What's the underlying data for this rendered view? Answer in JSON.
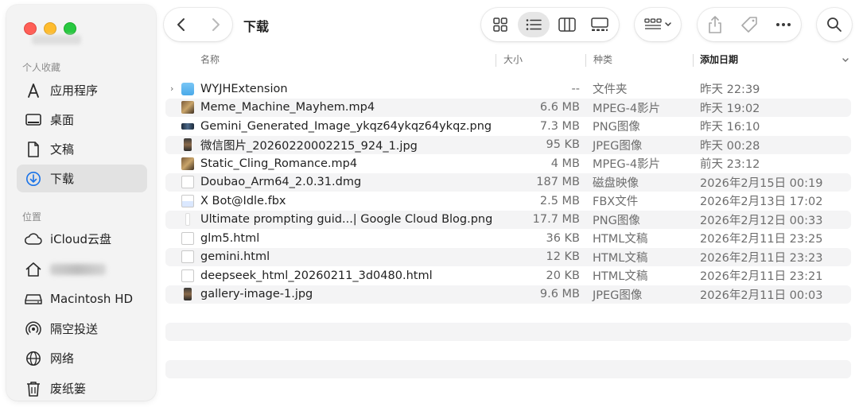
{
  "window": {
    "title": "下载",
    "colors": {
      "accent": "#1a73e8",
      "red": "#ff5f57",
      "yellow": "#febc2e",
      "green": "#28c840",
      "row_alt": "#f4f4f5"
    }
  },
  "sidebar": {
    "favorites_title": "个人收藏",
    "locations_title": "位置",
    "favorites": [
      {
        "label": "应用程序",
        "icon": "applications-icon"
      },
      {
        "label": "桌面",
        "icon": "desktop-icon"
      },
      {
        "label": "文稿",
        "icon": "document-icon"
      },
      {
        "label": "下载",
        "icon": "download-icon",
        "selected": true
      }
    ],
    "locations": [
      {
        "label": "iCloud云盘",
        "icon": "cloud-icon"
      },
      {
        "label": "",
        "icon": "home-icon",
        "obscured": true
      },
      {
        "label": "Macintosh HD",
        "icon": "disk-icon"
      },
      {
        "label": "隔空投送",
        "icon": "airdrop-icon"
      },
      {
        "label": "网络",
        "icon": "globe-icon"
      },
      {
        "label": "废纸篓",
        "icon": "trash-icon"
      }
    ]
  },
  "toolbar": {
    "back_icon": "chevron-left-icon",
    "forward_icon": "chevron-right-icon",
    "view_icons": [
      "icon-view-icon",
      "list-view-icon",
      "column-view-icon",
      "gallery-view-icon"
    ],
    "active_view": "list-view-icon",
    "group_icon": "group-by-icon",
    "share_icon": "share-icon",
    "tag_icon": "tag-icon",
    "more_icon": "ellipsis-icon",
    "search_icon": "search-icon"
  },
  "columns": {
    "name": "名称",
    "size": "大小",
    "kind": "种类",
    "date": "添加日期"
  },
  "files": [
    {
      "name": "WYJHExtension",
      "size": "--",
      "kind": "文件夹",
      "date": "昨天 22:39",
      "type": "folder"
    },
    {
      "name": "Meme_Machine_Mayhem.mp4",
      "size": "6.6 MB",
      "kind": "MPEG-4影片",
      "date": "昨天 19:02",
      "type": "video"
    },
    {
      "name": "Gemini_Generated_Image_ykqz64ykqz64ykqz.png",
      "size": "7.3 MB",
      "kind": "PNG图像",
      "date": "昨天 16:10",
      "type": "image-dark"
    },
    {
      "name": "微信图片_20260220002215_924_1.jpg",
      "size": "95 KB",
      "kind": "JPEG图像",
      "date": "昨天 00:28",
      "type": "image-phone"
    },
    {
      "name": "Static_Cling_Romance.mp4",
      "size": "4 MB",
      "kind": "MPEG-4影片",
      "date": "前天 23:12",
      "type": "video"
    },
    {
      "name": "Doubao_Arm64_2.0.31.dmg",
      "size": "187 MB",
      "kind": "磁盘映像",
      "date": "2026年2月15日 00:19",
      "type": "doc"
    },
    {
      "name": "X Bot@Idle.fbx",
      "size": "2.5 MB",
      "kind": "FBX文件",
      "date": "2026年2月13日 17:02",
      "type": "doc-blue"
    },
    {
      "name": "Ultimate prompting guid...| Google Cloud Blog.png",
      "size": "17.7 MB",
      "kind": "PNG图像",
      "date": "2026年2月12日 00:33",
      "type": "image-tall"
    },
    {
      "name": "glm5.html",
      "size": "36 KB",
      "kind": "HTML文稿",
      "date": "2026年2月11日 23:25",
      "type": "doc"
    },
    {
      "name": "gemini.html",
      "size": "12 KB",
      "kind": "HTML文稿",
      "date": "2026年2月11日 23:23",
      "type": "doc"
    },
    {
      "name": "deepseek_html_20260211_3d0480.html",
      "size": "20 KB",
      "kind": "HTML文稿",
      "date": "2026年2月11日 23:21",
      "type": "doc"
    },
    {
      "name": "gallery-image-1.jpg",
      "size": "9.6 MB",
      "kind": "JPEG图像",
      "date": "2026年2月11日 00:03",
      "type": "image-phone"
    }
  ]
}
